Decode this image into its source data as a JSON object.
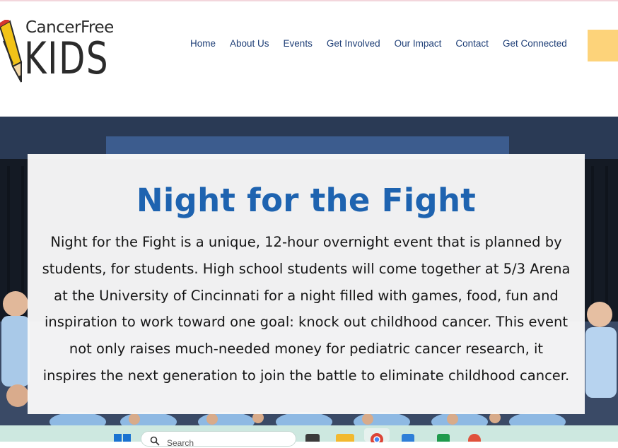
{
  "logo": {
    "line1": "CancerFree",
    "line2": "KIDS"
  },
  "nav": {
    "items": [
      "Home",
      "About Us",
      "Events",
      "Get Involved",
      "Our Impact",
      "Contact",
      "Get Connected"
    ]
  },
  "hero": {
    "title": "Night for the Fight",
    "body": "Night for the Fight is a unique, 12-hour overnight event that is planned by students, for students. High school students will come together at 5/3 Arena at the University of Cincinnati for a night filled with games, food, fun and inspiration to work toward one goal: knock out childhood cancer. This event not only raises much-needed money for pediatric cancer research, it inspires the next generation to join the battle to eliminate childhood cancer."
  },
  "taskbar": {
    "search_placeholder": "Search",
    "icons": [
      "windows-start-icon",
      "search-icon",
      "task-view-icon",
      "file-explorer-icon",
      "chrome-icon",
      "app-icon",
      "app-icon",
      "app-icon"
    ]
  },
  "colors": {
    "nav_text": "#1f3f77",
    "title_blue": "#1e63b0",
    "cta_yellow": "#fdd37a",
    "taskbar": "#cde8e0"
  }
}
